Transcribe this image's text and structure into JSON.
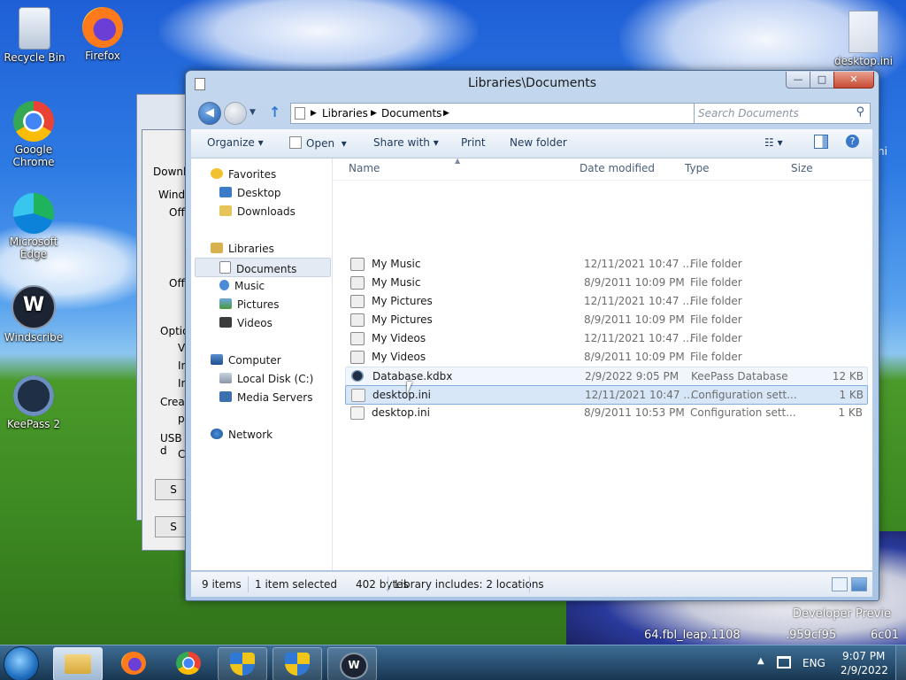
{
  "desktop": {
    "icons": [
      {
        "label": "Recycle Bin",
        "icon": "recycle-bin-icon"
      },
      {
        "label": "Firefox",
        "icon": "firefox-icon"
      },
      {
        "label": "Google Chrome",
        "icon": "chrome-icon"
      },
      {
        "label": "Microsoft Edge",
        "icon": "edge-icon"
      },
      {
        "label": "Windscribe",
        "icon": "windscribe-icon"
      },
      {
        "label": "KeePass 2",
        "icon": "keepass-icon"
      },
      {
        "label": "desktop.ini",
        "icon": "ini-file-icon"
      }
    ],
    "wallpaper_text": {
      "line1": "Developer Previe",
      "line2": "64.fbl_leap.1108",
      "line3": ".959cf95",
      "line4": "6c01"
    }
  },
  "background_dialog": {
    "fragments": [
      "Downlo",
      "Windo",
      "Off",
      "Off",
      "Optio",
      "Vo",
      "In",
      "In",
      "Creat",
      "pe",
      "USB d",
      "Co",
      "S",
      "S"
    ],
    "extra_fragment": "ni"
  },
  "explorer": {
    "title": "Libraries\\Documents",
    "caption": {
      "minimize": "—",
      "maximize": "□",
      "close": "✕"
    },
    "address": {
      "part1": "Libraries",
      "part2": "Documents"
    },
    "search_placeholder": "Search Documents",
    "toolbar": {
      "organize": "Organize",
      "open": "Open",
      "share_with": "Share with",
      "print": "Print",
      "new_folder": "New folder"
    },
    "nav": {
      "favorites": "Favorites",
      "desktop": "Desktop",
      "downloads": "Downloads",
      "libraries": "Libraries",
      "documents": "Documents",
      "music": "Music",
      "pictures": "Pictures",
      "videos": "Videos",
      "computer": "Computer",
      "local_disk": "Local Disk (C:)",
      "media_servers": "Media Servers",
      "network": "Network"
    },
    "columns": {
      "name": "Name",
      "date": "Date modified",
      "type": "Type",
      "size": "Size"
    },
    "files": [
      {
        "name": "My Music",
        "date": "12/11/2021 10:47 ...",
        "type": "File folder",
        "size": "",
        "icon": "folder-shortcut-icon"
      },
      {
        "name": "My Music",
        "date": "8/9/2011 10:09 PM",
        "type": "File folder",
        "size": "",
        "icon": "folder-shortcut-icon"
      },
      {
        "name": "My Pictures",
        "date": "12/11/2021 10:47 ...",
        "type": "File folder",
        "size": "",
        "icon": "folder-shortcut-icon"
      },
      {
        "name": "My Pictures",
        "date": "8/9/2011 10:09 PM",
        "type": "File folder",
        "size": "",
        "icon": "folder-shortcut-icon"
      },
      {
        "name": "My Videos",
        "date": "12/11/2021 10:47 ...",
        "type": "File folder",
        "size": "",
        "icon": "folder-shortcut-icon"
      },
      {
        "name": "My Videos",
        "date": "8/9/2011 10:09 PM",
        "type": "File folder",
        "size": "",
        "icon": "folder-shortcut-icon"
      },
      {
        "name": "Database.kdbx",
        "date": "2/9/2022 9:05 PM",
        "type": "KeePass Database",
        "size": "12 KB",
        "icon": "keepass-file-icon"
      },
      {
        "name": "desktop.ini",
        "date": "12/11/2021 10:47 ...",
        "type": "Configuration sett...",
        "size": "1 KB",
        "icon": "ini-file-icon"
      },
      {
        "name": "desktop.ini",
        "date": "8/9/2011 10:53 PM",
        "type": "Configuration sett...",
        "size": "1 KB",
        "icon": "ini-file-icon"
      }
    ],
    "status": {
      "items": "9 items",
      "selected": "1 item selected",
      "bytes": "402 bytes",
      "library": "Library includes: 2 locations"
    }
  },
  "taskbar": {
    "lang": "ENG",
    "time": "9:07 PM",
    "date": "2/9/2022"
  }
}
